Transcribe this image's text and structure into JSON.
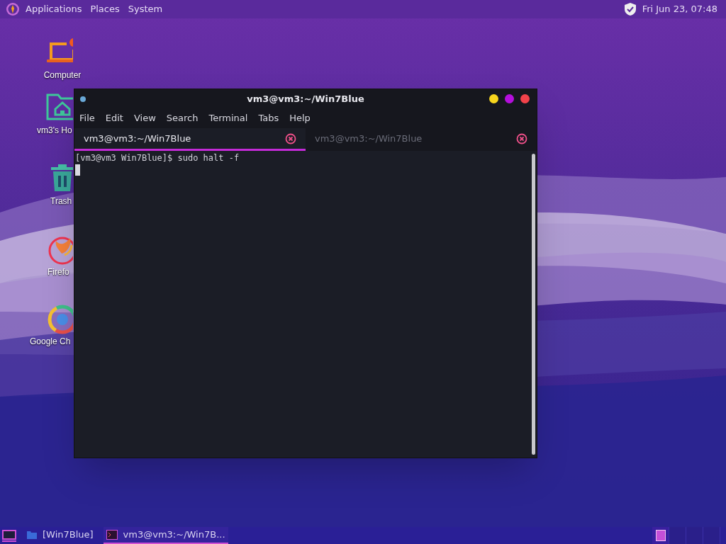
{
  "top_panel": {
    "menus": [
      "Applications",
      "Places",
      "System"
    ],
    "clock": "Fri Jun 23, 07:48"
  },
  "desktop_icons": [
    {
      "label": "Computer",
      "kind": "computer"
    },
    {
      "label": "vm3's Ho",
      "kind": "home"
    },
    {
      "label": "Trash",
      "kind": "trash"
    },
    {
      "label": "Firefo",
      "kind": "firefox"
    },
    {
      "label": "Google Ch",
      "kind": "chrome"
    }
  ],
  "terminal": {
    "title": "vm3@vm3:~/Win7Blue",
    "menus": [
      "File",
      "Edit",
      "View",
      "Search",
      "Terminal",
      "Tabs",
      "Help"
    ],
    "tabs": [
      {
        "label": "vm3@vm3:~/Win7Blue",
        "selected": true
      },
      {
        "label": "vm3@vm3:~/Win7Blue",
        "selected": false
      }
    ],
    "lines": [
      "[vm3@vm3 Win7Blue]$ sudo halt -f"
    ]
  },
  "taskbar": {
    "items": [
      {
        "label": "[Win7Blue]",
        "kind": "folder",
        "selected": false
      },
      {
        "label": "vm3@vm3:~/Win7B...",
        "kind": "terminal",
        "selected": true
      }
    ],
    "workspaces": [
      {
        "selected": true
      },
      {
        "selected": false
      },
      {
        "selected": false
      },
      {
        "selected": false
      }
    ]
  }
}
